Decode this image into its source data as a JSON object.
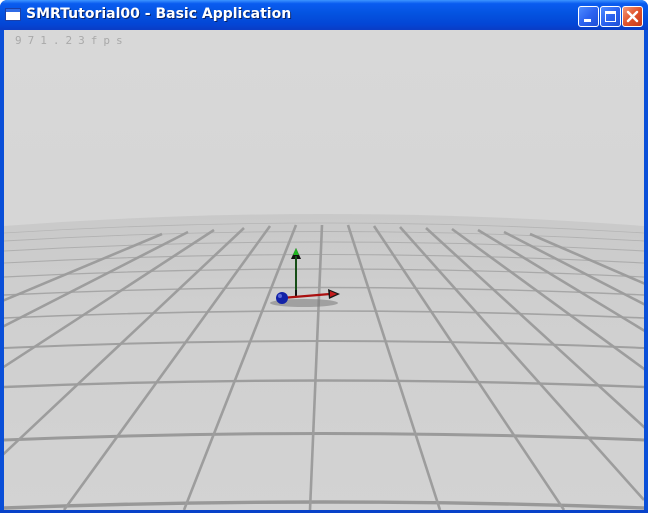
{
  "window": {
    "title": "SMRTutorial00 - Basic Application"
  },
  "titlebar_buttons": {
    "minimize_icon": "minimize-icon",
    "maximize_icon": "maximize-icon",
    "close_icon": "close-icon"
  },
  "viewport": {
    "fps": "971.23fps"
  },
  "colors": {
    "titlebar": "#0453e0",
    "sky": "#d6d6d6",
    "ground": "#cfcfcf",
    "grid": "#9a9a9a",
    "axis_x": "#d42020",
    "axis_y": "#1a9a1a",
    "axis_z": "#1a1aa8"
  }
}
